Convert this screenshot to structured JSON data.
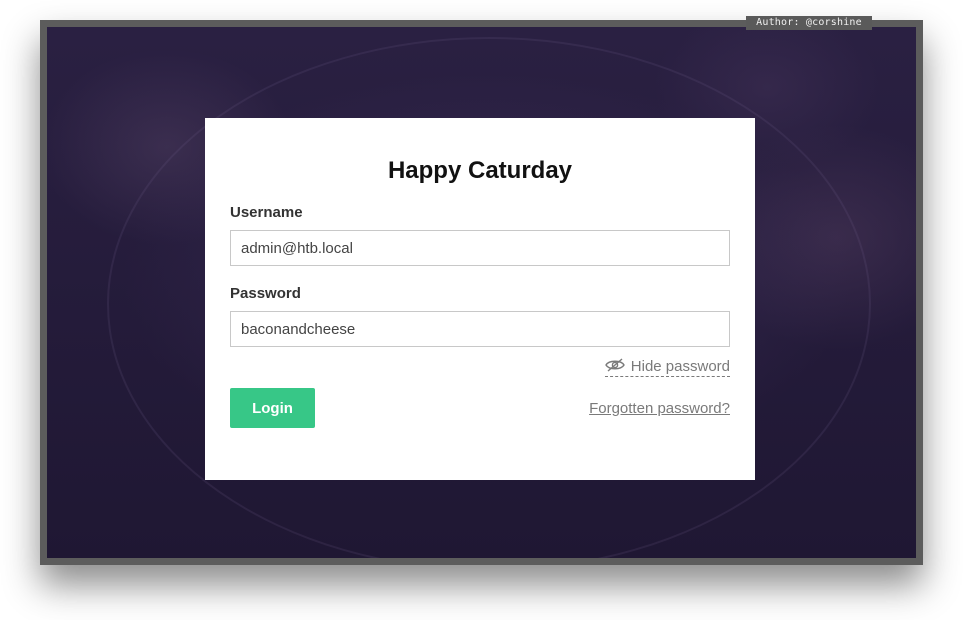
{
  "author_tag": "Author: @corshine",
  "login": {
    "title": "Happy Caturday",
    "username_label": "Username",
    "username_value": "admin@htb.local",
    "password_label": "Password",
    "password_value": "baconandcheese",
    "hide_password_label": "Hide password",
    "hide_password_icon": "eye-slash-icon",
    "login_button_label": "Login",
    "forgot_password_label": "Forgotten password?"
  },
  "colors": {
    "login_button": "#37c787",
    "background": "#231a3a",
    "frame": "#5c5c5c"
  }
}
